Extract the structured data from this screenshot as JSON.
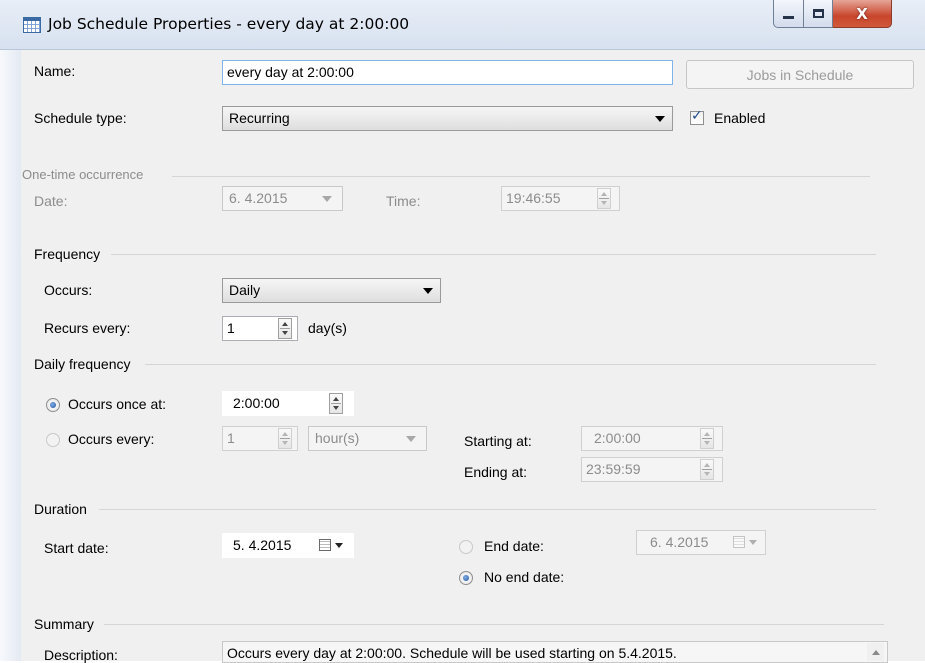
{
  "window": {
    "title": "Job Schedule Properties - every day at 2:00:00",
    "close_glyph": "X"
  },
  "general": {
    "name_label": "Name:",
    "name_value": "every day at 2:00:00",
    "jobs_button": "Jobs in Schedule",
    "schedule_type_label": "Schedule type:",
    "schedule_type_value": "Recurring",
    "enabled_label": "Enabled",
    "enabled_checked": true
  },
  "one_time": {
    "group_label": "One-time occurrence",
    "date_label": "Date:",
    "date_value": "6. 4.2015",
    "time_label": "Time:",
    "time_value": "19:46:55"
  },
  "frequency": {
    "group_label": "Frequency",
    "occurs_label": "Occurs:",
    "occurs_value": "Daily",
    "recurs_label": "Recurs every:",
    "recurs_value": "1",
    "recurs_unit": "day(s)"
  },
  "daily_frequency": {
    "group_label": "Daily frequency",
    "once_label": "Occurs once at:",
    "once_value": "2:00:00",
    "once_selected": true,
    "every_label": "Occurs every:",
    "every_value": "1",
    "every_unit": "hour(s)",
    "starting_label": "Starting at:",
    "starting_value": "2:00:00",
    "ending_label": "Ending at:",
    "ending_value": "23:59:59"
  },
  "duration": {
    "group_label": "Duration",
    "start_label": "Start date:",
    "start_value": "5. 4.2015",
    "end_label": "End date:",
    "end_value": "6. 4.2015",
    "no_end_label": "No end date:",
    "no_end_selected": true
  },
  "summary": {
    "group_label": "Summary",
    "description_label": "Description:",
    "description_value": "Occurs every day at 2:00:00. Schedule will be used starting on 5.4.2015."
  },
  "icons": [
    "calendar-grid-icon",
    "minimize-icon",
    "maximize-icon",
    "close-icon",
    "dropdown-arrow-icon",
    "spin-arrows-icon",
    "calendar-icon",
    "checkmark-icon"
  ]
}
